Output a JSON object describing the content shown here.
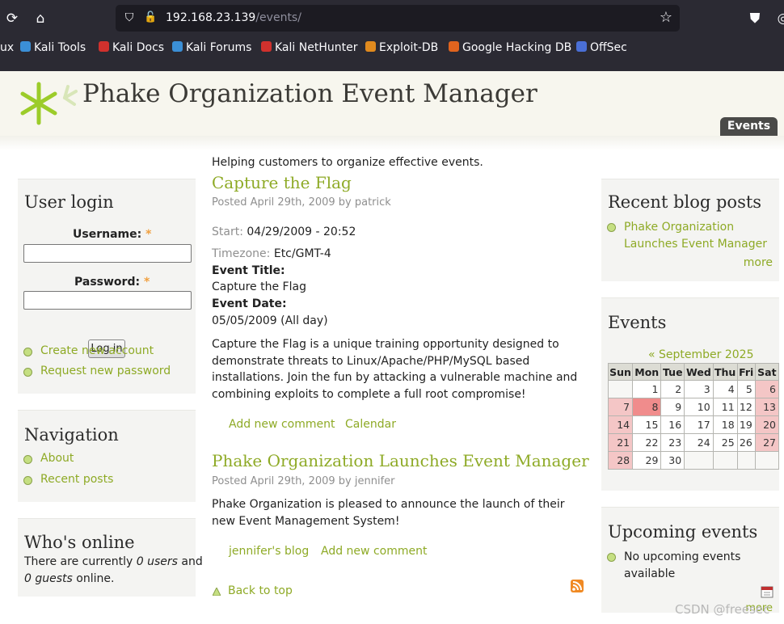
{
  "browser": {
    "url_host": "192.168.23.139",
    "url_path": "/events/",
    "bookmarks": [
      {
        "label": "ux",
        "color": "#000000"
      },
      {
        "label": "Kali Tools",
        "color": "#3b8fd6"
      },
      {
        "label": "Kali Docs",
        "color": "#d0312d"
      },
      {
        "label": "Kali Forums",
        "color": "#3b8fd6"
      },
      {
        "label": "Kali NetHunter",
        "color": "#d0312d"
      },
      {
        "label": "Exploit-DB",
        "color": "#e08a1e"
      },
      {
        "label": "Google Hacking DB",
        "color": "#e0641e"
      },
      {
        "label": "OffSec",
        "color": "#4a6fd6"
      }
    ]
  },
  "site": {
    "name": "Phake Organization Event Manager",
    "tab": "Events",
    "slogan": "Helping customers to organize effective events."
  },
  "user_login": {
    "title": "User login",
    "username_label": "Username:",
    "password_label": "Password:",
    "required_mark": "*",
    "button": "Log in",
    "links": [
      "Create new account",
      "Request new password"
    ]
  },
  "navigation": {
    "title": "Navigation",
    "links": [
      "About",
      "Recent posts"
    ]
  },
  "whos_online": {
    "title": "Who's online",
    "text_1": "There are currently ",
    "users": "0 users",
    "text_2": " and",
    "guests": "0 guests",
    "text_3": " online."
  },
  "posts": [
    {
      "title": "Capture the Flag",
      "meta": "Posted April 29th, 2009 by patrick",
      "start_label": "Start:",
      "start_value": "04/29/2009 - 20:52",
      "tz_label": "Timezone:",
      "tz_value": "Etc/GMT-4",
      "event_title_label": "Event Title:",
      "event_title": "Capture the Flag",
      "event_date_label": "Event Date:",
      "event_date": "05/05/2009 (All day)",
      "body": "Capture the Flag is a unique training opportunity designed to demonstrate threats to Linux/Apache/PHP/MySQL based installations. Join the fun by attacking a vulnerable machine and combining exploits to complete a full root compromise!",
      "links": [
        "Add new comment",
        "Calendar"
      ]
    },
    {
      "title": "Phake Organization Launches Event Manager",
      "meta": "Posted April 29th, 2009 by jennifer",
      "body": "Phake Organization is pleased to announce the launch of their new Event Management System!",
      "links": [
        "jennifer's blog",
        "Add new comment"
      ]
    }
  ],
  "back_to_top": "Back to top",
  "recent_blog": {
    "title": "Recent blog posts",
    "item": "Phake Organization Launches Event Manager",
    "more": "more"
  },
  "events_block": {
    "title": "Events",
    "month_nav": "« September 2025",
    "days": [
      "Sun",
      "Mon",
      "Tue",
      "Wed",
      "Thu",
      "Fri",
      "Sat"
    ],
    "weeks": [
      [
        "",
        "1",
        "2",
        "3",
        "4",
        "5",
        "6"
      ],
      [
        "7",
        "8",
        "9",
        "10",
        "11",
        "12",
        "13"
      ],
      [
        "14",
        "15",
        "16",
        "17",
        "18",
        "19",
        "20"
      ],
      [
        "21",
        "22",
        "23",
        "24",
        "25",
        "26",
        "27"
      ],
      [
        "28",
        "29",
        "30",
        "",
        "",
        "",
        ""
      ]
    ],
    "today": "8"
  },
  "upcoming": {
    "title": "Upcoming events",
    "text": "No upcoming events available",
    "more": "more"
  },
  "watermark": "CSDN @freesec"
}
